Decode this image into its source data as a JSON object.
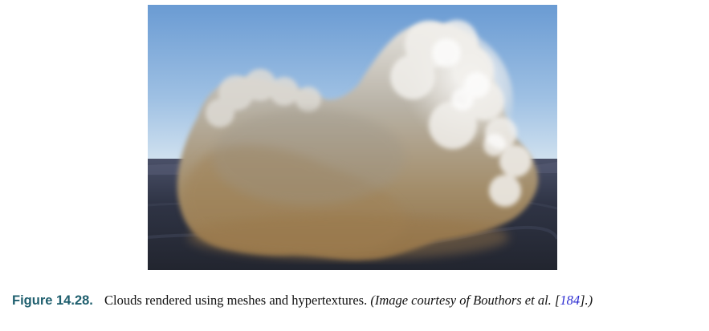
{
  "figure": {
    "label": "Figure 14.28.",
    "caption": "Clouds rendered using meshes and hypertextures.",
    "courtesy_prefix": "(Image courtesy of Bouthors et al. [",
    "citation": "184",
    "courtesy_suffix": "].)",
    "colors": {
      "label": "#1f5f6e",
      "citation_link": "#2a2ad0",
      "sky_top": "#6a9bd3",
      "sky_horizon": "#e6eff6",
      "ground": "#2f3445",
      "cloud_light": "#f2f0ec",
      "cloud_base": "#a88a5c"
    }
  }
}
